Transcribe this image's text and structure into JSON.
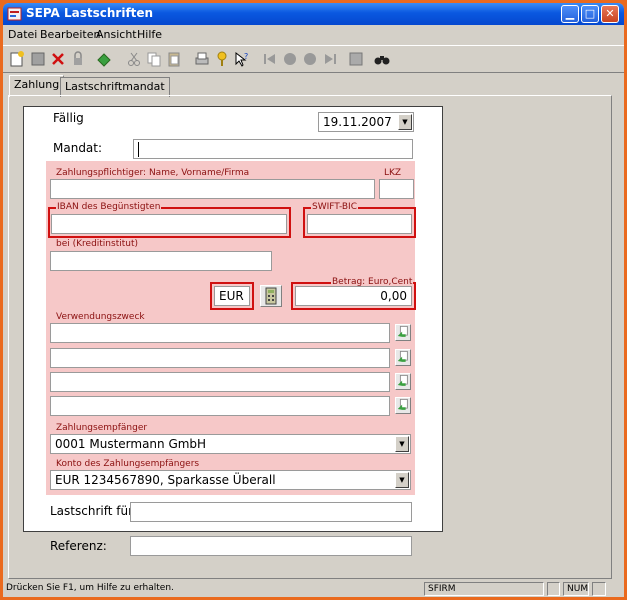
{
  "window": {
    "title": "SEPA Lastschriften"
  },
  "menu": [
    "Datei",
    "Bearbeiten",
    "Ansicht",
    "Hilfe"
  ],
  "toolbar_icons": [
    "new-icon",
    "save-icon",
    "delete-icon",
    "lock-icon",
    "refresh-icon",
    "cut-icon",
    "copy-icon",
    "paste-icon",
    "print-icon",
    "help-icon",
    "context-help-icon",
    "first-record-icon",
    "previous-record-icon",
    "next-record-icon",
    "last-record-icon",
    "list-icon",
    "search-binoculars-icon"
  ],
  "tabs": {
    "payment": "Zahlung",
    "mandate": "Lastschriftmandat"
  },
  "form": {
    "due_label": "Fällig",
    "due_value": "19.11.2007",
    "mandate_label": "Mandat:",
    "mandate_value": "",
    "debtor_label": "Zahlungspflichtiger: Name, Vorname/Firma",
    "debtor_value": "",
    "country_label": "LKZ",
    "country_value": "",
    "iban_label": "IBAN des Begünstigten",
    "iban_value": "",
    "bic_label": "SWIFT-BIC",
    "bic_value": "",
    "bank_label": "bei (Kreditinstitut)",
    "bank_value": "",
    "currency_value": "EUR",
    "amount_label": "Betrag: Euro,Cent",
    "amount_value": "0,00",
    "purpose_label": "Verwendungszweck",
    "purpose_lines": [
      "",
      "",
      "",
      ""
    ],
    "creditor_label": "Zahlungsempfänger",
    "creditor_value": "0001 Mustermann GmbH",
    "creditor_account_label": "Konto des Zahlungsempfängers",
    "creditor_account_value": "EUR 1234567890, Sparkasse Überall",
    "debit_for_label": "Lastschrift für:",
    "debit_for_value": "",
    "reference_label": "Referenz:",
    "reference_value": ""
  },
  "status": {
    "message": "Drücken Sie F1, um Hilfe zu erhalten.",
    "app": "SFIRM",
    "num": "NUM"
  },
  "colors": {
    "accent_red": "#d01010",
    "form_pink": "#f6c8c8",
    "title_blue": "#0a58e0",
    "desktop_orange": "#ea6a1e"
  }
}
